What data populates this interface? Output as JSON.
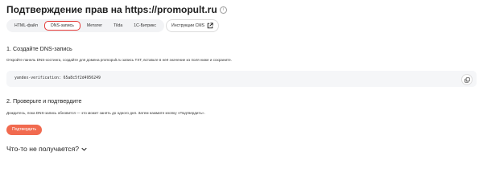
{
  "header": {
    "title": "Подтверждение прав на https://promopult.ru",
    "info_icon": "info-icon"
  },
  "tabs": [
    {
      "label": "HTML-файл",
      "active": false
    },
    {
      "label": "DNS-запись",
      "active": true
    },
    {
      "label": "Метатег",
      "active": false
    },
    {
      "label": "Tilda",
      "active": false
    },
    {
      "label": "1С-Битрикс",
      "active": false
    }
  ],
  "cms_button": {
    "label": "Инструкции CMS",
    "icon": "external-link-icon"
  },
  "step1": {
    "heading": "1. Создайте DNS-запись",
    "description": "Откройте панель DNS-хостинга, создайте для домена promopult.ru запись TXT, вставьте в неё значение из поля ниже и сохраните.",
    "code_value": "yandex-verification: 65a8c5f2d4956249",
    "copy_icon": "copy-icon"
  },
  "step2": {
    "heading": "2. Проверьте и подтвердите",
    "description": "Дождитесь, пока DNS-запись обновится — это может занять до одного дня. Затем нажмите кнопку «Подтвердить»."
  },
  "confirm_button": {
    "label": "Подтвердить"
  },
  "trouble": {
    "label": "Что-то не получается?",
    "icon": "chevron-down-icon"
  },
  "colors": {
    "accent": "#f16a4f",
    "active_tab_border": "#e53935",
    "tabs_bg": "#f2f3f5",
    "code_bg": "#f5f6f8"
  }
}
